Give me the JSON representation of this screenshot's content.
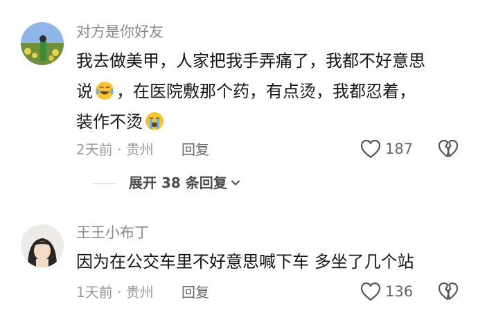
{
  "comments": [
    {
      "username": "对方是你好友",
      "lines": [
        "我去做美甲，人家把我手弄痛了，我都不好意思",
        "，在医院敷那个药，有点烫，我都忍着，",
        "装作不烫"
      ],
      "line2_prefix": "说",
      "time": "2天前",
      "location": "贵州",
      "reply_label": "回复",
      "likes": "187",
      "expand_label": "展开 38 条回复"
    },
    {
      "username": "王王小布丁",
      "lines": [
        "因为在公交车里不好意思喊下车 多坐了几个站"
      ],
      "time": "1天前",
      "location": "贵州",
      "reply_label": "回复",
      "likes": "136"
    }
  ],
  "icons": {
    "like": "heart-outline-icon",
    "dislike": "broken-heart-icon",
    "expand": "chevron-down-icon",
    "emoji_1": "crying-laughing-emoji",
    "emoji_2": "loudly-crying-emoji"
  }
}
